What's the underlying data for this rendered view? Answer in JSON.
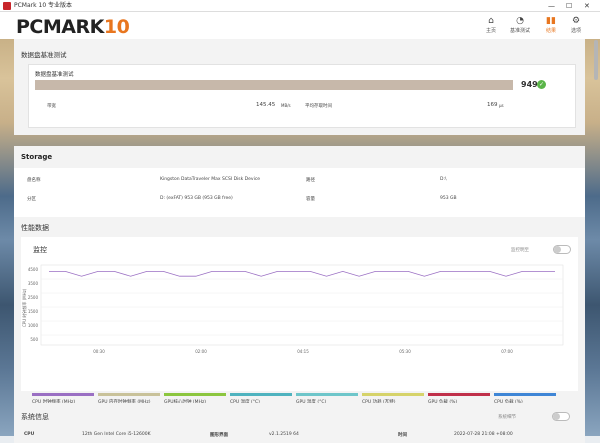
{
  "window": {
    "title": "PCMark 10 专业版本"
  },
  "header": {
    "logo_main": "PCMARK",
    "logo_num": "10"
  },
  "nav": {
    "home": "主页",
    "benchmarks": "基准测试",
    "results": "结果",
    "options": "选项"
  },
  "benchmark": {
    "section_title": "数据盘基准测试",
    "test_name": "数据盘基准测试",
    "score": "949",
    "bandwidth_label": "带宽",
    "bandwidth_value": "145.45",
    "bandwidth_unit": "MB/s",
    "latency_label": "平均存取时间",
    "latency_value": "169",
    "latency_unit": "μs"
  },
  "storage": {
    "title": "Storage",
    "rows": [
      {
        "label": "盘名称",
        "value": "Kingston DataTraveler Max SCSI Disk Device"
      },
      {
        "label": "路径",
        "value": "D:\\"
      },
      {
        "label": "分区",
        "value": "D: (exFAT) 953 GB (953 GB free)"
      },
      {
        "label": "容量",
        "value": "953 GB"
      }
    ]
  },
  "performance": {
    "title": "性能数据",
    "monitor_title": "监控",
    "show_markers": "监控明至",
    "markers_label": "标记"
  },
  "chart_data": {
    "type": "line",
    "ylabel": "CPU 时钟频率 (MHz)",
    "ylim": [
      0,
      5000
    ],
    "yticks": [
      "4500",
      "3500",
      "2500",
      "1500",
      "1000",
      "500"
    ],
    "xticks": [
      "00:30",
      "02:00",
      "04:15",
      "05:30",
      "07:00"
    ],
    "series": [
      {
        "name": "CPU 时钟频率 (MHz)",
        "color": "#9a6fc3",
        "values": [
          4600,
          4600,
          4300,
          4600,
          4600,
          4300,
          4600,
          4600,
          4300,
          4300,
          4600,
          4600,
          4600,
          4300,
          4600,
          4600,
          4600,
          4300,
          4600,
          4300,
          4600,
          4600,
          4600,
          4300,
          4600,
          4600,
          4600,
          4600,
          4300,
          4600,
          4600,
          4600
        ]
      }
    ],
    "legend": [
      {
        "name": "CPU 时钟频率 (MHz)",
        "color": "#9a6fc3"
      },
      {
        "name": "GPU 内存时钟频率 (MHz)",
        "color": "#c9c29a"
      },
      {
        "name": "GPU核心时钟 (MHz)",
        "color": "#8cc63f"
      },
      {
        "name": "CPU 温度 (°C)",
        "color": "#4fb3bf"
      },
      {
        "name": "GPU 温度 (°C)",
        "color": "#6ec6ca"
      },
      {
        "name": "CPU 功耗 (瓦特)",
        "color": "#d6d36a"
      },
      {
        "name": "GPU 负载 (%)",
        "color": "#c0304a"
      },
      {
        "name": "CPU 负载 (%)",
        "color": "#3f86d6"
      }
    ]
  },
  "system": {
    "title": "系统信息",
    "details_label": "系统细节",
    "cpu_label": "CPU",
    "cpu_value": "12th Gen Intel Core i5-12600K",
    "gui_label": "图形界面",
    "gui_value": "v2.1.2519 64",
    "time_label": "时间",
    "time_value": "2022-07-28 21:08 +08:00"
  }
}
